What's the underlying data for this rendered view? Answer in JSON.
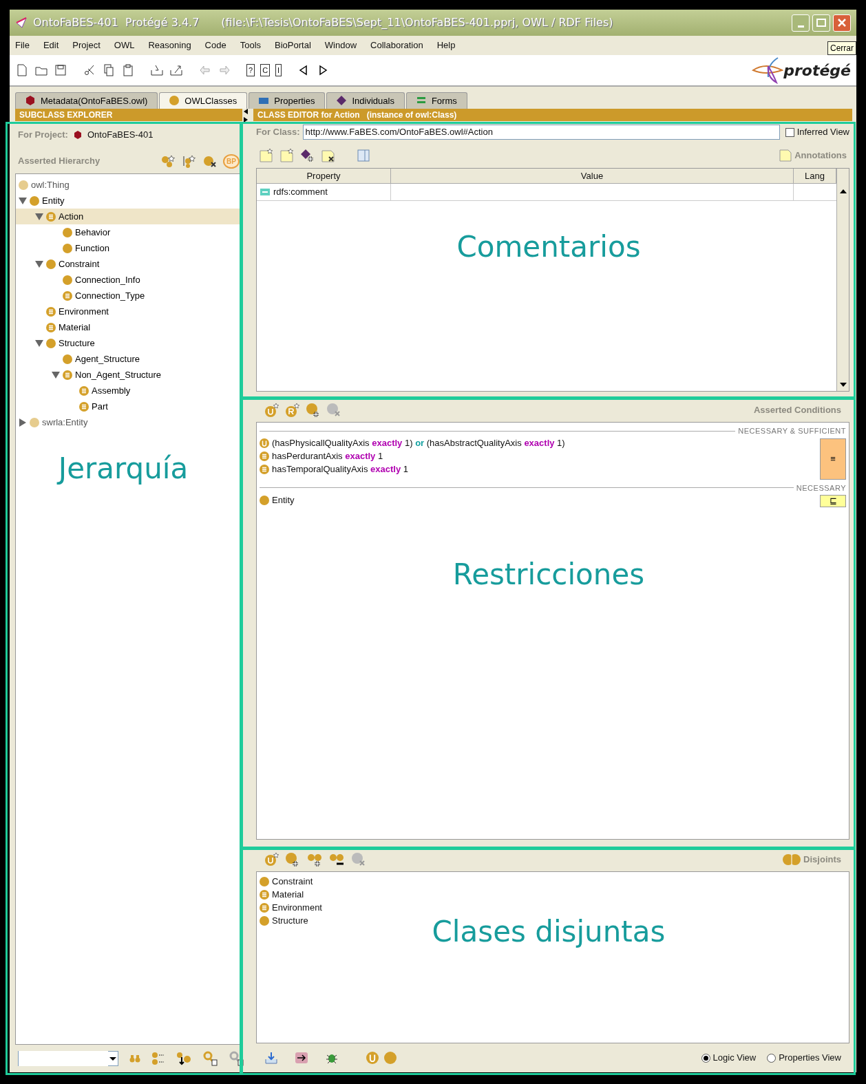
{
  "window": {
    "title": "OntoFaBES-401  Protégé 3.4.7",
    "file_info": "(file:\\F:\\Tesis\\OntoFaBES\\Sept_11\\OntoFaBES-401.pprj, OWL / RDF Files)",
    "close_tooltip": "Cerrar"
  },
  "menu": [
    "File",
    "Edit",
    "Project",
    "OWL",
    "Reasoning",
    "Code",
    "Tools",
    "BioPortal",
    "Window",
    "Collaboration",
    "Help"
  ],
  "toolbar": {
    "glyphs": [
      "?",
      "C",
      "I"
    ],
    "logo": "protégé"
  },
  "tabs": [
    {
      "label": "Metadata(OntoFaBES.owl)",
      "kind": "metadata",
      "selected": false
    },
    {
      "label": "OWLClasses",
      "kind": "classes",
      "selected": true
    },
    {
      "label": "Properties",
      "kind": "properties",
      "selected": false
    },
    {
      "label": "Individuals",
      "kind": "individuals",
      "selected": false
    },
    {
      "label": "Forms",
      "kind": "forms",
      "selected": false
    }
  ],
  "subclass_explorer": {
    "header": "SUBCLASS EXPLORER",
    "project_label": "For Project:",
    "project_name": "OntoFaBES-401",
    "hierarchy_label": "Asserted Hierarchy",
    "badge": "BP",
    "tree": [
      {
        "label": "owl:Thing",
        "kind": "thing",
        "selected": false
      },
      {
        "label": "Entity",
        "kind": "primitive",
        "expanded": true,
        "selected": false,
        "children": [
          {
            "label": "Action",
            "kind": "defined",
            "expanded": true,
            "selected": true,
            "children": [
              {
                "label": "Behavior",
                "kind": "primitive",
                "selected": false
              },
              {
                "label": "Function",
                "kind": "primitive",
                "selected": false
              }
            ]
          },
          {
            "label": "Constraint",
            "kind": "primitive",
            "expanded": true,
            "selected": false,
            "children": [
              {
                "label": "Connection_Info",
                "kind": "primitive",
                "selected": false
              },
              {
                "label": "Connection_Type",
                "kind": "defined",
                "selected": false
              }
            ]
          },
          {
            "label": "Environment",
            "kind": "defined",
            "selected": false
          },
          {
            "label": "Material",
            "kind": "defined",
            "selected": false
          },
          {
            "label": "Structure",
            "kind": "primitive",
            "expanded": true,
            "selected": false,
            "children": [
              {
                "label": "Agent_Structure",
                "kind": "primitive",
                "selected": false
              },
              {
                "label": "Non_Agent_Structure",
                "kind": "defined",
                "expanded": true,
                "selected": false,
                "children": [
                  {
                    "label": "Assembly",
                    "kind": "defined",
                    "selected": false
                  },
                  {
                    "label": "Part",
                    "kind": "defined",
                    "selected": false
                  }
                ]
              }
            ]
          }
        ]
      },
      {
        "label": "swrla:Entity",
        "kind": "thing",
        "expanded": false,
        "selected": false
      }
    ]
  },
  "class_editor": {
    "header": "CLASS EDITOR for Action   (instance of owl:Class)",
    "for_class_label": "For Class:",
    "uri": "http://www.FaBES.com/OntoFaBES.owl#Action",
    "inferred_view": {
      "label": "Inferred View",
      "checked": false
    },
    "annotations_label": "Annotations",
    "table": {
      "columns": [
        "Property",
        "Value",
        "Lang"
      ],
      "rows": [
        {
          "property": "rdfs:comment"
        }
      ]
    }
  },
  "conditions": {
    "title": "Asserted Conditions",
    "sections": [
      {
        "label": "NECESSARY & SUFFICIENT",
        "symbol": "≡",
        "kind": "equivalent",
        "items": [
          {
            "kind": "union",
            "parts": [
              {
                "text": "(hasPhysicallQualityAxis",
                "kind": "plain"
              },
              {
                "text": "exactly",
                "kind": "keyword"
              },
              {
                "text": "1)",
                "kind": "plain"
              },
              {
                "text": "or",
                "kind": "operator"
              },
              {
                "text": "(hasAbstractQualityAxis",
                "kind": "plain"
              },
              {
                "text": "exactly",
                "kind": "keyword"
              },
              {
                "text": "1)",
                "kind": "plain"
              }
            ]
          },
          {
            "kind": "defined",
            "parts": [
              {
                "text": "hasPerdurantAxis",
                "kind": "plain"
              },
              {
                "text": "exactly",
                "kind": "keyword"
              },
              {
                "text": "1",
                "kind": "plain"
              }
            ]
          },
          {
            "kind": "defined",
            "parts": [
              {
                "text": "hasTemporalQualityAxis",
                "kind": "plain"
              },
              {
                "text": "exactly",
                "kind": "keyword"
              },
              {
                "text": "1",
                "kind": "plain"
              }
            ]
          }
        ]
      },
      {
        "label": "NECESSARY",
        "symbol": "⊑",
        "kind": "subclass",
        "items": [
          {
            "kind": "primitive",
            "parts": [
              {
                "text": "Entity",
                "kind": "plain"
              }
            ]
          }
        ]
      }
    ]
  },
  "disjoints": {
    "title": "Disjoints",
    "items": [
      {
        "label": "Constraint",
        "kind": "primitive"
      },
      {
        "label": "Material",
        "kind": "defined"
      },
      {
        "label": "Environment",
        "kind": "defined"
      },
      {
        "label": "Structure",
        "kind": "primitive"
      }
    ]
  },
  "footer": {
    "views": [
      {
        "label": "Logic View",
        "selected": true
      },
      {
        "label": "Properties View",
        "selected": false
      }
    ]
  },
  "overlay": [
    "Jerarquía",
    "Comentarios",
    "Restricciones",
    "Clases disjuntas"
  ]
}
